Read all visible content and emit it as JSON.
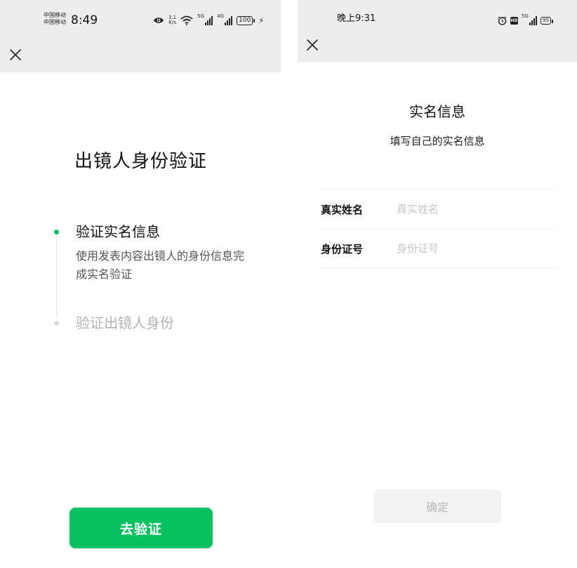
{
  "left": {
    "status": {
      "carrier_line1": "中国移动",
      "carrier_line2": "中国移动",
      "time": "8:49",
      "speed_value": "3.1",
      "speed_unit": "K/s",
      "sim1_tag": "5G",
      "sim2_tag": "4G",
      "battery": "100"
    },
    "title": "出镜人身份验证",
    "steps": [
      {
        "title": "验证实名信息",
        "description": "使用发表内容出镜人的身份信息完成实名验证"
      },
      {
        "title": "验证出镜人身份"
      }
    ],
    "button_label": "去验证"
  },
  "right": {
    "status": {
      "time": "晚上9:31",
      "hd_tag": "HD",
      "network_tag": "5G",
      "battery": "95"
    },
    "title": "实名信息",
    "subtitle": "填写自己的实名信息",
    "fields": [
      {
        "label": "真实姓名",
        "value": "",
        "placeholder": "真实姓名"
      },
      {
        "label": "身份证号",
        "value": "",
        "placeholder": "身份证号"
      }
    ],
    "confirm_label": "确定"
  },
  "colors": {
    "accent": "#07c160",
    "topbar": "#ededed",
    "disabled_button": "#f2f2f2"
  },
  "icons": [
    "close-icon",
    "eye-icon",
    "wifi-icon",
    "signal-icon",
    "battery-icon",
    "charging-icon",
    "alarm-icon",
    "hd-icon"
  ]
}
